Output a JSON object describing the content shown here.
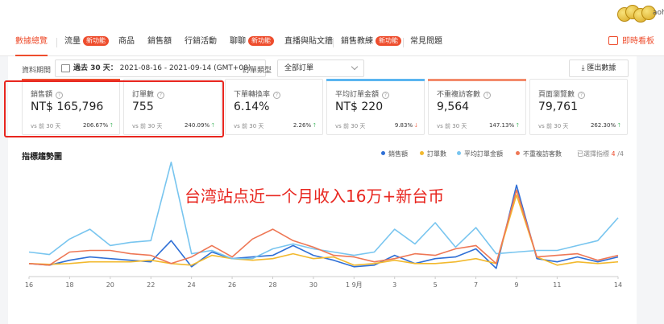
{
  "topbar": {
    "user_text": "aoh"
  },
  "nav": {
    "items": [
      {
        "label": "數據總覽"
      },
      {
        "label": "流量",
        "badge": "新功能"
      },
      {
        "label": "商品"
      },
      {
        "label": "銷售額"
      },
      {
        "label": "行銷活動"
      },
      {
        "label": "聊聊",
        "badge": "新功能"
      },
      {
        "label": "直播與貼文牆"
      },
      {
        "label": "銷售教練",
        "badge": "新功能"
      },
      {
        "label": "常見問題"
      }
    ],
    "realtime": "即時看板"
  },
  "filter": {
    "period_label": "資料期間",
    "period_bold": "過去 30 天：",
    "period_range": "2021-08-16 - 2021-09-14 (GMT+08)",
    "order_type_label": "訂單類型",
    "order_type_value": "全部訂單",
    "export_label": "匯出數據"
  },
  "metrics": [
    {
      "label": "銷售額",
      "value": "NT$ 165,796",
      "vs": "vs 前 30 天",
      "change": "206.67%",
      "dir": "up",
      "bar": "#ee4d2d"
    },
    {
      "label": "訂單數",
      "value": "755",
      "vs": "vs 前 30 天",
      "change": "240.09%",
      "dir": "up",
      "bar": ""
    },
    {
      "label": "下單轉換率",
      "value": "6.14%",
      "vs": "vs 前 30 天",
      "change": "2.26%",
      "dir": "up",
      "bar": ""
    },
    {
      "label": "平均訂單金額",
      "value": "NT$ 220",
      "vs": "vs 前 30 天",
      "change": "9.83%",
      "dir": "down",
      "bar": "#5bb5f0"
    },
    {
      "label": "不重複訪客數",
      "value": "9,564",
      "vs": "vs 前 30 天",
      "change": "147.13%",
      "dir": "up",
      "bar": "#f38b6b"
    },
    {
      "label": "頁面瀏覽數",
      "value": "79,761",
      "vs": "vs 前 30 天",
      "change": "262.30%",
      "dir": "up",
      "bar": ""
    }
  ],
  "chart": {
    "title": "指標趨勢圖",
    "legend": [
      {
        "name": "銷售額",
        "color": "#2f6fd6"
      },
      {
        "name": "訂單數",
        "color": "#f2b92e"
      },
      {
        "name": "平均訂單金額",
        "color": "#78c5ef"
      },
      {
        "name": "不重複訪客數",
        "color": "#ee7755"
      }
    ],
    "selected_label": "已選擇指標",
    "selected_count": "4",
    "selected_total": "/4"
  },
  "chart_data": {
    "type": "line",
    "x_tick_labels": [
      "16",
      "18",
      "20",
      "22",
      "24",
      "26",
      "28",
      "30",
      "1 9月",
      "3",
      "5",
      "7",
      "9",
      "11",
      "14"
    ],
    "x": [
      "08-16",
      "08-17",
      "08-18",
      "08-19",
      "08-20",
      "08-21",
      "08-22",
      "08-23",
      "08-24",
      "08-25",
      "08-26",
      "08-27",
      "08-28",
      "08-29",
      "08-30",
      "08-31",
      "09-01",
      "09-02",
      "09-03",
      "09-04",
      "09-05",
      "09-06",
      "09-07",
      "09-08",
      "09-09",
      "09-10",
      "09-11",
      "09-12",
      "09-13",
      "09-14"
    ],
    "series": [
      {
        "name": "銷售額",
        "color": "#2f6fd6",
        "values": [
          16,
          14,
          20,
          24,
          22,
          20,
          18,
          44,
          12,
          30,
          22,
          24,
          26,
          38,
          26,
          20,
          12,
          14,
          26,
          16,
          22,
          24,
          34,
          10,
          112,
          22,
          18,
          24,
          18,
          24
        ]
      },
      {
        "name": "訂單數",
        "color": "#f2b92e",
        "values": [
          16,
          15,
          16,
          18,
          18,
          18,
          20,
          16,
          14,
          26,
          22,
          20,
          22,
          28,
          22,
          24,
          14,
          16,
          20,
          16,
          16,
          18,
          22,
          16,
          100,
          24,
          14,
          18,
          16,
          18
        ]
      },
      {
        "name": "平均訂單金額",
        "color": "#78c5ef",
        "values": [
          30,
          27,
          46,
          58,
          38,
          42,
          44,
          140,
          28,
          32,
          22,
          22,
          34,
          40,
          34,
          30,
          26,
          30,
          58,
          40,
          66,
          36,
          60,
          28,
          30,
          32,
          32,
          38,
          44,
          72
        ]
      },
      {
        "name": "不重複訪客數",
        "color": "#ee7755",
        "values": [
          16,
          14,
          30,
          32,
          32,
          28,
          26,
          16,
          24,
          38,
          24,
          46,
          58,
          44,
          36,
          26,
          24,
          18,
          22,
          28,
          26,
          34,
          38,
          16,
          106,
          24,
          26,
          28,
          20,
          26
        ]
      }
    ],
    "ylim": [
      0,
      130
    ]
  },
  "overlay": {
    "text": "台湾站点近一个月收入16万+新台币"
  }
}
